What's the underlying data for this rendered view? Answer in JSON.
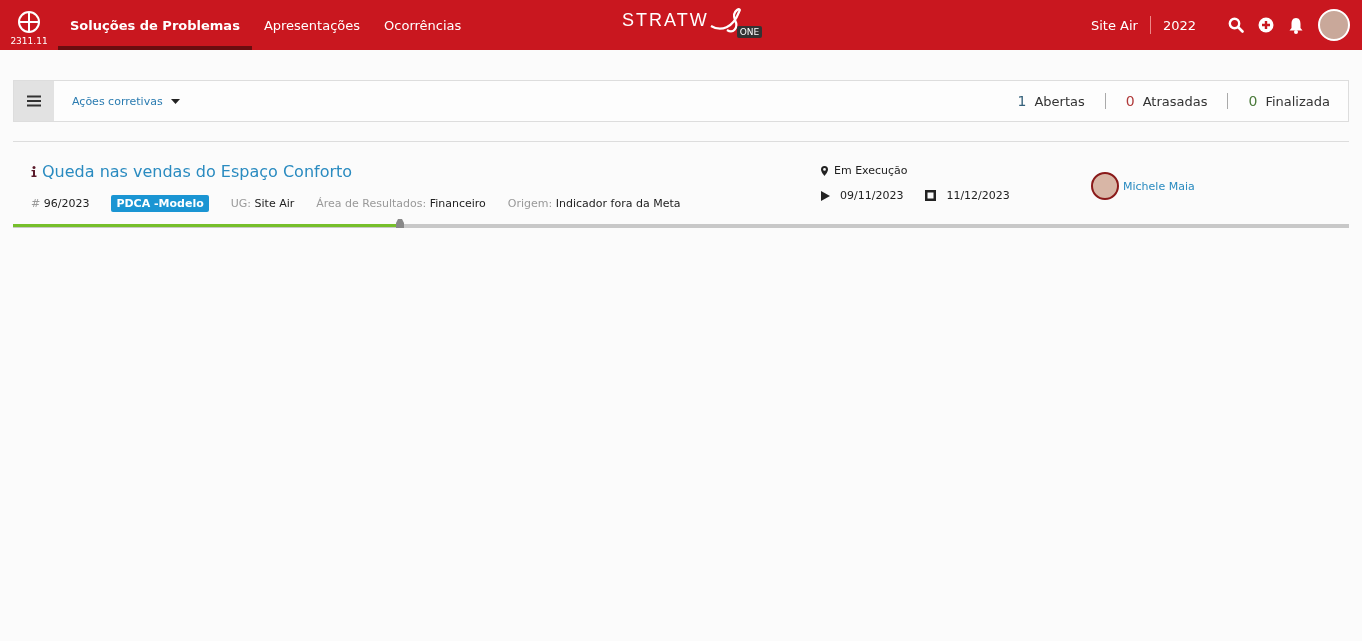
{
  "header": {
    "version": "2311.11",
    "nav": [
      {
        "label": "Soluções de Problemas",
        "selected": true
      },
      {
        "label": "Apresentações",
        "selected": false
      },
      {
        "label": "Ocorrências",
        "selected": false
      }
    ],
    "logo": {
      "text": "STRATW",
      "badge": "ONE"
    },
    "unit": "Site Air",
    "year": "2022"
  },
  "toolbar": {
    "filter": "Ações corretivas",
    "counters": [
      {
        "count": "1",
        "label": "Abertas",
        "color": "#34607a"
      },
      {
        "count": "0",
        "label": "Atrasadas",
        "color": "#b03a3a"
      },
      {
        "count": "0",
        "label": "Finalizada",
        "color": "#4a7a3a"
      }
    ]
  },
  "items": [
    {
      "title": "Queda nas vendas do Espaço Conforto",
      "number_prefix": "#",
      "number": "96/2023",
      "tag": "PDCA -Modelo",
      "fields": [
        {
          "label": "UG:",
          "value": "Site Air"
        },
        {
          "label": "Área de Resultados:",
          "value": "Financeiro"
        },
        {
          "label": "Origem:",
          "value": "Indicador fora da Meta"
        }
      ],
      "status": "Em Execução",
      "start": "09/11/2023",
      "end": "11/12/2023",
      "owner": "Michele Maia",
      "level": 0.29
    }
  ]
}
